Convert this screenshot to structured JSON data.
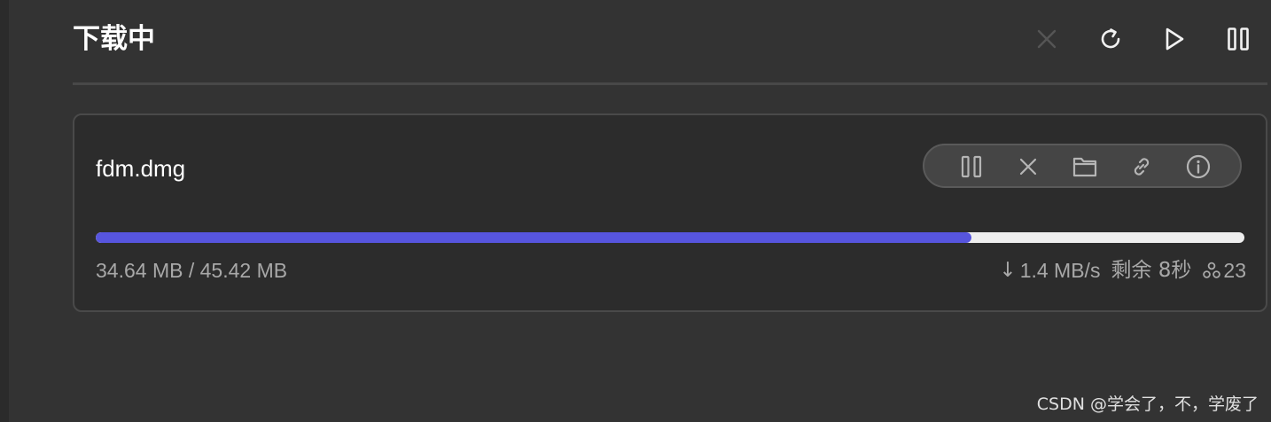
{
  "header": {
    "title": "下载中",
    "actions": [
      {
        "icon": "close-icon",
        "enabled": false
      },
      {
        "icon": "refresh-icon",
        "enabled": true
      },
      {
        "icon": "play-icon",
        "enabled": true
      },
      {
        "icon": "pause-icon",
        "enabled": true
      }
    ]
  },
  "download": {
    "file_name": "fdm.dmg",
    "toolbar": [
      "pause-icon",
      "close-icon",
      "folder-icon",
      "link-icon",
      "info-icon"
    ],
    "downloaded": "34.64 MB",
    "total": "45.42 MB",
    "size_text": "34.64 MB / 45.42 MB",
    "progress": 0.7627,
    "speed_arrow": "↓",
    "speed": "1.4 MB/s",
    "remaining": "剩余 8秒",
    "peers": "23"
  },
  "colors": {
    "background": "#333333",
    "card": "#2c2c2c",
    "accent": "#5755de",
    "track": "#eeeeee",
    "muted_text": "#a8a8a8",
    "disabled_icon": "#5a5a5a"
  },
  "watermark": "CSDN @学会了，不，学废了"
}
